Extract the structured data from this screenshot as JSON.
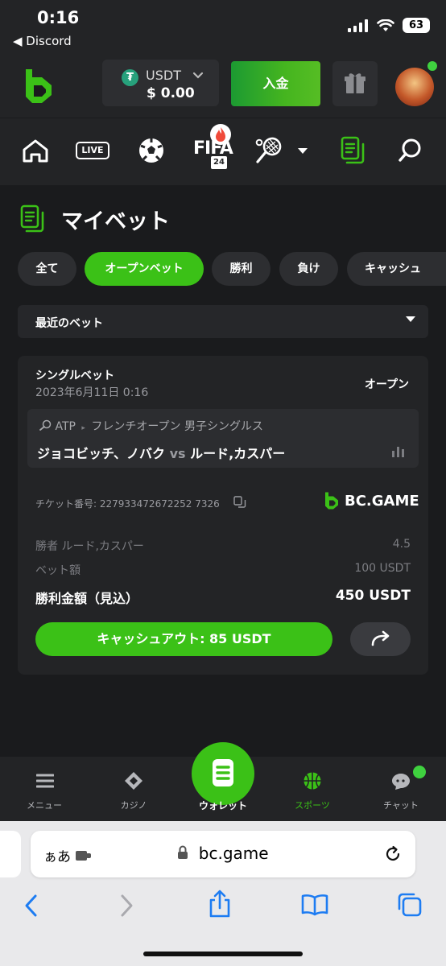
{
  "status_bar": {
    "time": "0:16",
    "back_app": "◀ Discord",
    "battery": "63"
  },
  "header": {
    "currency": "USDT",
    "currency_symbol": "₮",
    "balance": "$ 0.00",
    "deposit_label": "入金"
  },
  "nav": {
    "live_label": "LIVE",
    "fifa_label": "FIFA",
    "fifa_year": "24"
  },
  "page": {
    "title": "マイベット"
  },
  "tabs": [
    {
      "label": "全て"
    },
    {
      "label": "オープンベット"
    },
    {
      "label": "勝利"
    },
    {
      "label": "負け"
    },
    {
      "label": "キャッシュ"
    }
  ],
  "filter": {
    "selected": "最近のベット"
  },
  "bet": {
    "type": "シングルベット",
    "date": "2023年6月11日 0:16",
    "status": "オープン",
    "league_tour": "ATP",
    "league_event": "フレンチオープン 男子シングルス",
    "team1": "ジョコビッチ、ノバク",
    "vs": "vs",
    "team2": "ルード,カスパー",
    "ticket": "チケット番号: 227933472672252 7326",
    "brand": "BC.GAME",
    "selection_label": "勝者 ルード,カスパー",
    "odds": "4.5",
    "stake_label": "ベット額",
    "stake": "100 USDT",
    "payout_label": "勝利金額（見込）",
    "payout": "450 USDT",
    "cashout_label": "キャッシュアウト: 85 USDT"
  },
  "bottom_nav": {
    "menu": "メニュー",
    "casino": "カジノ",
    "wallet": "ウォレット",
    "sports": "スポーツ",
    "chat": "チャット"
  },
  "browser": {
    "aa": "ぁあ",
    "url": "bc.game"
  },
  "colors": {
    "accent": "#3bc117",
    "background": "#1a1b1d",
    "panel": "#232426"
  }
}
